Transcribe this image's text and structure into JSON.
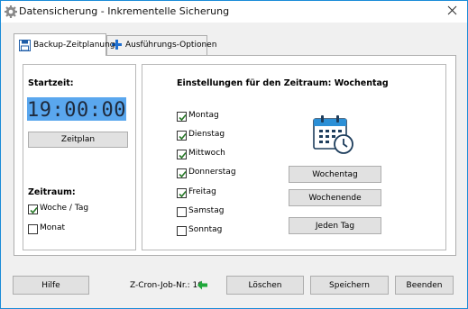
{
  "window": {
    "title": "Datensicherung - Inkrementelle Sicherung",
    "accent": "#1a8cd8"
  },
  "tabs": [
    {
      "label": "Backup-Zeitplanung",
      "icon": "floppy-disk-icon",
      "active": true
    },
    {
      "label": "Ausführungs-Optionen",
      "icon": "plus-icon",
      "active": false
    }
  ],
  "left": {
    "start_label": "Startzeit:",
    "time": "19:00:00",
    "schedule_button": "Zeitplan",
    "period_label": "Zeitraum:",
    "periods": [
      {
        "label": "Woche / Tag",
        "checked": true
      },
      {
        "label": "Monat",
        "checked": false
      }
    ]
  },
  "right": {
    "heading": "Einstellungen für den Zeitraum: Wochentag",
    "days": [
      {
        "label": "Montag",
        "checked": true
      },
      {
        "label": "Dienstag",
        "checked": true
      },
      {
        "label": "Mittwoch",
        "checked": true
      },
      {
        "label": "Donnerstag",
        "checked": true
      },
      {
        "label": "Freitag",
        "checked": true
      },
      {
        "label": "Samstag",
        "checked": false
      },
      {
        "label": "Sonntag",
        "checked": false
      }
    ],
    "buttons": {
      "weekday": "Wochentag",
      "weekend": "Wochenende",
      "every_day": "Jeden Tag"
    }
  },
  "footer": {
    "help": "Hilfe",
    "job": "Z-Cron-Job-Nr.: 10",
    "delete": "Löschen",
    "save": "Speichern",
    "exit": "Beenden"
  },
  "colors": {
    "lcd_bg": "#5aa7ee",
    "lcd_text": "#1f2a3c",
    "check": "#2a7a2a",
    "arrow": "#1fa83a"
  }
}
